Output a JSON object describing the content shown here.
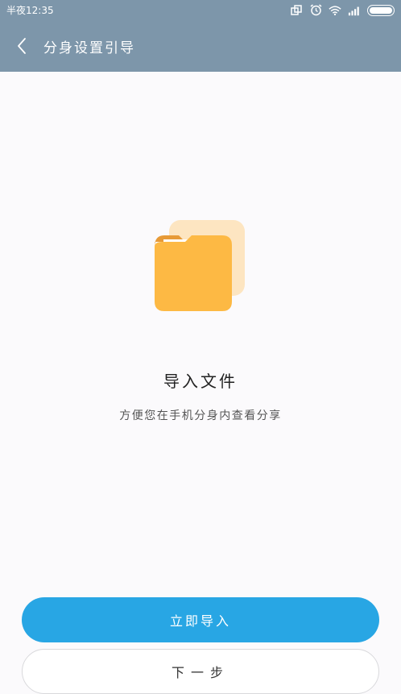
{
  "status_bar": {
    "time": "半夜12:35",
    "icons": [
      "multi-window-icon",
      "alarm-icon",
      "wifi-icon",
      "signal-icon",
      "battery-icon"
    ]
  },
  "header": {
    "title": "分身设置引导",
    "back_icon": "back-arrow-icon"
  },
  "main": {
    "illustration_icon": "folder-icon",
    "heading": "导入文件",
    "description": "方便您在手机分身内查看分享"
  },
  "actions": {
    "primary_label": "立即导入",
    "secondary_label": "下一步"
  },
  "colors": {
    "header_bg": "#7d96aa",
    "primary": "#28a6e4",
    "folder_front": "#fdb944",
    "folder_back": "#fde5c1",
    "folder_tab": "#e79a37"
  }
}
